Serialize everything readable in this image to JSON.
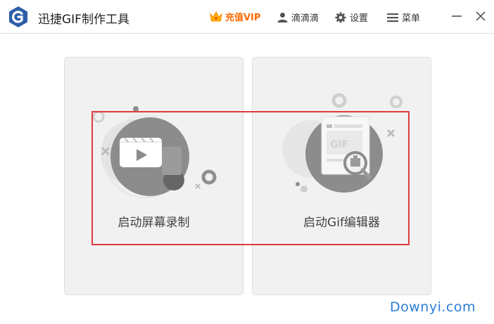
{
  "titlebar": {
    "app_icon": "app-logo-g",
    "title": "迅捷GIF制作工具",
    "vip_label": "充值VIP",
    "vip_icon": "crown-icon",
    "username": "滴滴滴",
    "settings_label": "设置",
    "menu_label": "菜单"
  },
  "cards": [
    {
      "label": "启动屏幕录制",
      "icon": "video-record-icon"
    },
    {
      "label": "启动Gif编辑器",
      "icon": "gif-editor-icon"
    }
  ],
  "watermark": "Downyi.com",
  "colors": {
    "accent": "#2d5fa8",
    "vip": "#ff6a00",
    "highlight": "#e03a3e",
    "card_bg": "#f1f1f1"
  }
}
